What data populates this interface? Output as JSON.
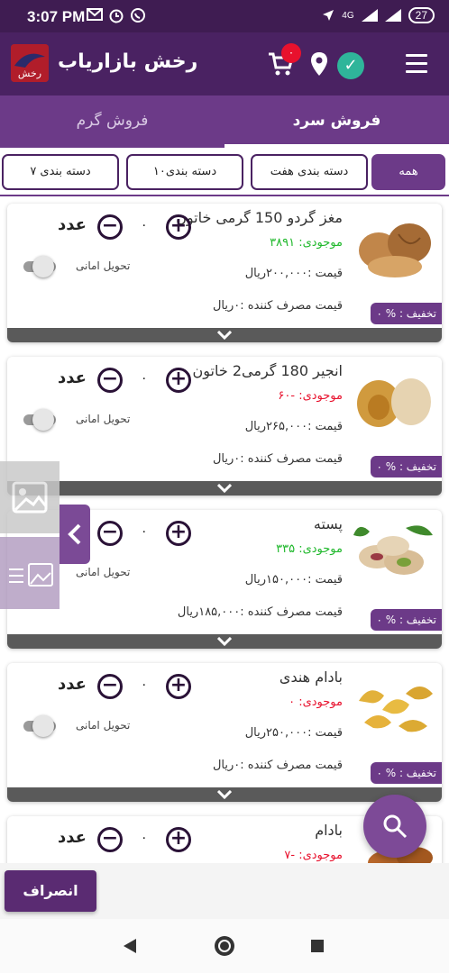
{
  "status_bar": {
    "time": "3:07 PM",
    "battery": "27",
    "network": "4G"
  },
  "header": {
    "app_title": "رخش بازاریاب",
    "cart_count": "۰",
    "logo_text": "رخش"
  },
  "tabs": [
    {
      "label": "فروش گرم"
    },
    {
      "label": "فروش سرد"
    }
  ],
  "categories": [
    "همه",
    "دسته بندی هفت",
    "دسته بندی۱۰",
    "دسته بندی ۷"
  ],
  "products": [
    {
      "name": "مغز گردو 150 گرمی خاتون",
      "stock": "موجودی: ۳۸۹۱",
      "stock_color": "#1fb82b",
      "price": "قیمت :۲۰۰,۰۰۰ریال",
      "consumer_price": "قیمت مصرف کننده :۰ریال",
      "discount": "تخفیف : % ۰",
      "qty": "۰",
      "unit": "عدد",
      "delivery_label": "تحویل امانی"
    },
    {
      "name": "انجیر 180 گرمی2 خاتون",
      "stock": "موجودی: -۶۰",
      "stock_color": "#e8112d",
      "price": "قیمت :۲۶۵,۰۰۰ریال",
      "consumer_price": "قیمت مصرف کننده :۰ریال",
      "discount": "تخفیف : % ۰",
      "qty": "۰",
      "unit": "عدد",
      "delivery_label": "تحویل امانی"
    },
    {
      "name": "پسته",
      "stock": "موجودی: ۳۳۵",
      "stock_color": "#1fb82b",
      "price": "قیمت :۱۵۰,۰۰۰ریال",
      "consumer_price": "قیمت مصرف کننده :۱۸۵,۰۰۰ریال",
      "discount": "تخفیف : % ۰",
      "qty": "۰",
      "unit": "عدد",
      "delivery_label": "تحویل امانی"
    },
    {
      "name": "بادام هندی",
      "stock": "موجودی: ۰",
      "stock_color": "#e8112d",
      "price": "قیمت :۲۵۰,۰۰۰ریال",
      "consumer_price": "قیمت مصرف کننده :۰ریال",
      "discount": "تخفیف : % ۰",
      "qty": "۰",
      "unit": "عدد",
      "delivery_label": "تحویل امانی"
    },
    {
      "name": "بادام",
      "stock": "موجودی: -۷",
      "stock_color": "#e8112d",
      "price": "",
      "consumer_price": "",
      "discount": "",
      "qty": "۰",
      "unit": "عدد",
      "delivery_label": ""
    }
  ],
  "cancel_label": "انصراف",
  "colors": {
    "primary": "#4a2262",
    "accent": "#6c3a88",
    "in_stock": "#1fb82b",
    "out_stock": "#e8112d"
  }
}
